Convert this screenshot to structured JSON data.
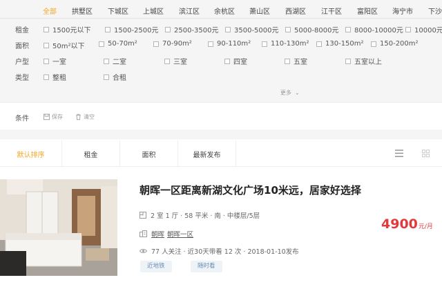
{
  "regions": {
    "items": [
      "全部",
      "拱墅区",
      "下城区",
      "上城区",
      "滨江区",
      "余杭区",
      "萧山区",
      "西湖区",
      "江干区",
      "富阳区",
      "海宁市",
      "下沙"
    ],
    "active_index": 0
  },
  "filters": {
    "rent": {
      "label": "租金",
      "options": [
        "1500元以下",
        "1500-2500元",
        "2500-3500元",
        "3500-5000元",
        "5000-8000元",
        "8000-10000元",
        "10000元"
      ]
    },
    "area": {
      "label": "面积",
      "options": [
        "50m²以下",
        "50-70m²",
        "70-90m²",
        "90-110m²",
        "110-130m²",
        "130-150m²",
        "150-200m²"
      ]
    },
    "layout": {
      "label": "户型",
      "options": [
        "一室",
        "二室",
        "三室",
        "四室",
        "五室",
        "五室以上"
      ]
    },
    "type": {
      "label": "类型",
      "options": [
        "整租",
        "合租"
      ]
    },
    "more_label": "更多"
  },
  "conditions": {
    "label": "条件",
    "save_label": "保存",
    "clear_label": "清空"
  },
  "sort": {
    "tabs": [
      "默认排序",
      "租金",
      "面积",
      "最新发布"
    ],
    "active_index": 0
  },
  "listing": {
    "title": "朝晖一区距离新湖文化广场10米远，居家好选择",
    "info": "2 室 1 厅 · 58 平米 · 南 · 中楼层/5层",
    "community_area": "朝晖",
    "community_name": "朝晖一区",
    "stats": "77 人关注 · 近30天带看 12 次 · 2018-01-10发布",
    "tags": [
      "近地铁",
      "随时看"
    ],
    "price": "4900",
    "price_unit": "元/月"
  },
  "colors": {
    "accent": "#f5a623",
    "price": "#e4393c",
    "tag_bg": "#eef3f8",
    "tag_text": "#6b8fb3"
  }
}
